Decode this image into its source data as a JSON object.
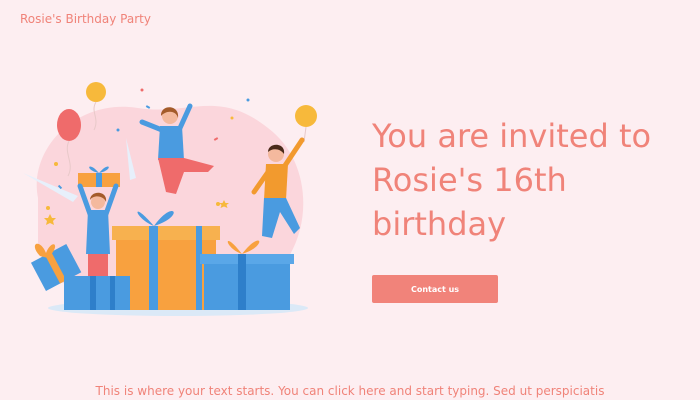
{
  "header": {
    "site_title": "Rosie's Birthday Party"
  },
  "hero": {
    "headline": "You are invited to Rosie's 16th birthday",
    "cta_label": "Contact us"
  },
  "body": {
    "text": "This is where your text starts. You can click here and start typing. Sed ut perspiciatis"
  },
  "colors": {
    "background": "#fdeef1",
    "accent": "#f08379",
    "button": "#f1837a",
    "button_text": "#ffffff"
  },
  "illustration": {
    "name": "birthday-party-illustration"
  }
}
